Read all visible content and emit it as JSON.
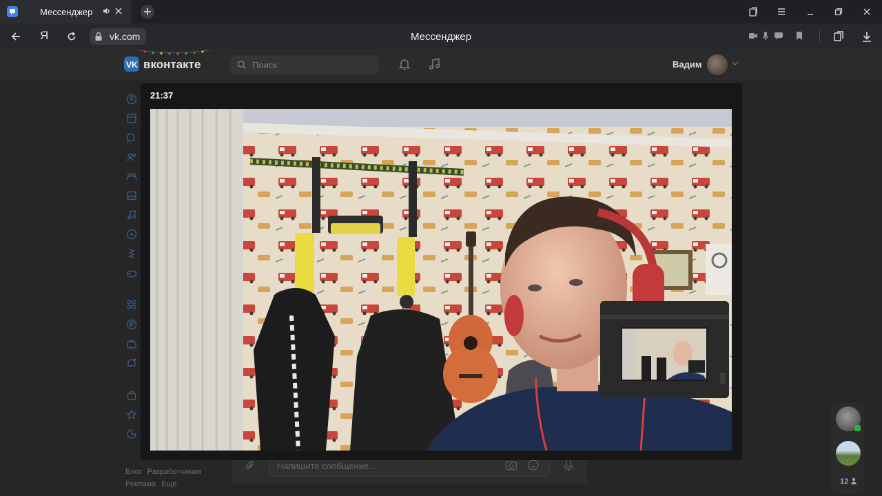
{
  "browser": {
    "tab_title": "Мессенджер",
    "address": "vk.com",
    "page_heading": "Мессенджер"
  },
  "vk": {
    "logo_text": "вконтакте",
    "search_placeholder": "Поиск",
    "user_name": "Вадим",
    "sidebar_icons": [
      "profile-icon",
      "news-icon",
      "messenger-icon",
      "friends-icon",
      "communities-icon",
      "photos-icon",
      "music-icon",
      "video-icon",
      "clips-icon",
      "games-icon",
      "services-icon",
      "pay-icon",
      "jobs-icon",
      "ads-icon",
      "shop-icon",
      "favorites-icon",
      "files-icon"
    ],
    "footer_links": [
      "Блог",
      "Разработчикам",
      "Реклама",
      "Ещё"
    ],
    "composer_placeholder": "Напишите сообщение..."
  },
  "call": {
    "time": "21:37",
    "participant_count": "12"
  },
  "colors": {
    "accent": "#2f6fb0",
    "modal_bg": "#171717",
    "page_bg": "#262626"
  }
}
